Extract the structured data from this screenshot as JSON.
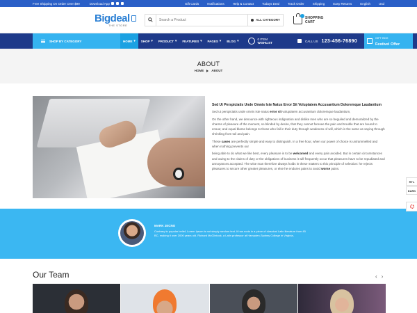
{
  "topbar": {
    "shipping": "Free Shipping On Order Over $99",
    "download": "Download App",
    "links": [
      "Gift Cards",
      "Notifications",
      "Help & Contact",
      "Todays Deal",
      "Track Order",
      "Shipping",
      "Easy Returns",
      "English",
      "Usd"
    ]
  },
  "header": {
    "logo_brand": "Bigdeal",
    "logo_sub": "THE STORE",
    "search_placeholder": "Search a Product",
    "all_category": "ALL CATEGORY",
    "cart_line1": "SHOPPING",
    "cart_line2": "CART"
  },
  "nav": {
    "shop_by_category": "SHOP BY CATEGORY",
    "items": [
      {
        "label": "HOME"
      },
      {
        "label": "SHOP"
      },
      {
        "label": "PRODUCT"
      },
      {
        "label": "FEATURES"
      },
      {
        "label": "PAGES"
      },
      {
        "label": "BLOG"
      }
    ],
    "wishlist_count": "0 ITEM",
    "wishlist_label": "WISHLIST",
    "call_label": "CALL US",
    "phone": "123-456-76890",
    "gift_small": "GIFT BOX",
    "gift_big": "Festivel Offer"
  },
  "banner": {
    "title": "ABOUT",
    "crumb_home": "HOME",
    "crumb_current": "ABOUT"
  },
  "about": {
    "heading": "Sed Ut Perspiciatis Unde Omnis Iste Natus Error Sit Voluptatem Accusantium Doloremque Laudantium",
    "p1_start": "Sed ut perspiciatis unde omnis iste natus",
    "p1_bold": "error sit",
    "p1_end": "voluptatem accusantium doloremque laudantium,",
    "p2": "On the other hand, we denounce with righteous indignation and dislike men who are so beguiled and demoralized by the charms of pleasure of the moment, so blinded by desire, that they cannot foresee the pain and trouble that are bound to ensue; and equal blame belongs to those who fail in their duty through weakness of will, which is the same as saying through shrinking from toil and pain.",
    "p3_start": "These",
    "p3_bold": "cases",
    "p3_end": "are perfectly simple and easy to distinguish. In a free hour, when our power of choice is untrammelled and when nothing prevents our",
    "p4_start": "being able to do what we like best, every pleasure is to be",
    "p4_bold1": "welcomed",
    "p4_mid": "and every pain avoided. But in certain circumstances and owing to the claims of duty or the obligations of business it will frequently occur that pleasures have to be repudiated and annoyances accepted. The wise man therefore always holds in these matters to this principle of selection: he rejects pleasures to secure other greater pleasures, or else he endures pains to avoid",
    "p4_bold2": "worse",
    "p4_end": "pains."
  },
  "testimonial": {
    "name": "MARK JECNO",
    "text": "Contrary to popular belief, Lorem Ipsum is not simply random text. It has roots in a piece of classical Latin literature from 45 BC, making it over 2000 years old. Richard McClintock, a Latin professor at Hampden-Sydney College in Virginia,"
  },
  "team": {
    "title": "Our Team",
    "prev": "‹",
    "next": "›"
  },
  "side": {
    "rtl": "RTL",
    "dark": "DARK"
  }
}
